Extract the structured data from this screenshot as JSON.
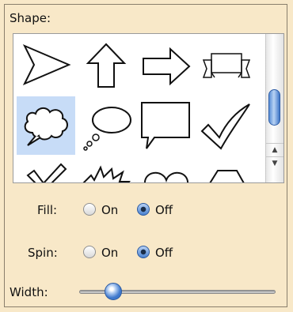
{
  "shape": {
    "label": "Shape:",
    "items": [
      {
        "name": "triangle-pointer"
      },
      {
        "name": "arrow-up"
      },
      {
        "name": "arrow-right"
      },
      {
        "name": "banner-scroll"
      },
      {
        "name": "thought-bubble-cloud",
        "selected": true
      },
      {
        "name": "thought-bubble-oval"
      },
      {
        "name": "speech-box"
      },
      {
        "name": "check-mark"
      },
      {
        "name": "check-mark-partial"
      },
      {
        "name": "explosion"
      },
      {
        "name": "heart"
      },
      {
        "name": "trapezoid"
      }
    ]
  },
  "fill": {
    "label": "Fill:",
    "on_label": "On",
    "off_label": "Off",
    "value": "Off"
  },
  "spin": {
    "label": "Spin:",
    "on_label": "On",
    "off_label": "Off",
    "value": "Off"
  },
  "width": {
    "label": "Width:",
    "value_fraction": 0.14
  },
  "colors": {
    "accent": "#3e78cc",
    "selection": "#c7dcf7",
    "panel": "#f8e8c8"
  }
}
